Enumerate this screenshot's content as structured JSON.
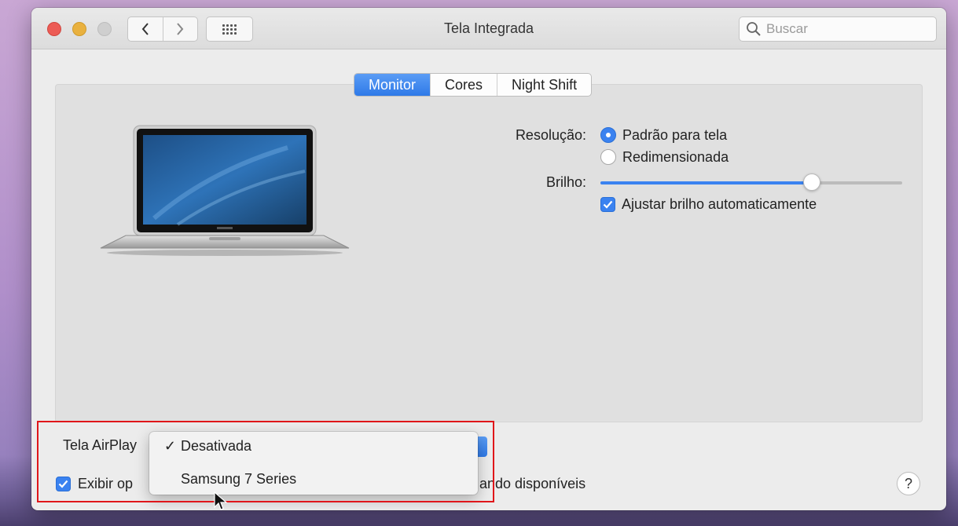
{
  "window": {
    "title": "Tela Integrada"
  },
  "search": {
    "placeholder": "Buscar"
  },
  "tabs": [
    {
      "label": "Monitor",
      "active": true
    },
    {
      "label": "Cores",
      "active": false
    },
    {
      "label": "Night Shift",
      "active": false
    }
  ],
  "resolution": {
    "label": "Resolução:",
    "options": [
      {
        "label": "Padrão para tela",
        "selected": true
      },
      {
        "label": "Redimensionada",
        "selected": false
      }
    ]
  },
  "brightness": {
    "label": "Brilho:",
    "level_percent": 70,
    "auto_label": "Ajustar brilho automaticamente",
    "auto_checked": true
  },
  "airplay": {
    "label": "Tela AirPlay",
    "menu": [
      {
        "label": "Desativada",
        "checked": true,
        "check_glyph": "✓"
      },
      {
        "label": "Samsung 7 Series",
        "checked": false,
        "check_glyph": ""
      }
    ]
  },
  "mirror_option": {
    "label_start": "Exibir op",
    "label_end": "ando disponíveis",
    "checked": true
  },
  "help": {
    "label": "?"
  },
  "colors": {
    "accent": "#3a82f0",
    "highlight_box": "#e0161a",
    "close": "#ec5b55",
    "minimize": "#e9b13f"
  },
  "icons": [
    "chevron-left-icon",
    "chevron-right-icon",
    "grid-icon",
    "search-icon",
    "laptop-icon",
    "pointer-cursor-icon"
  ]
}
